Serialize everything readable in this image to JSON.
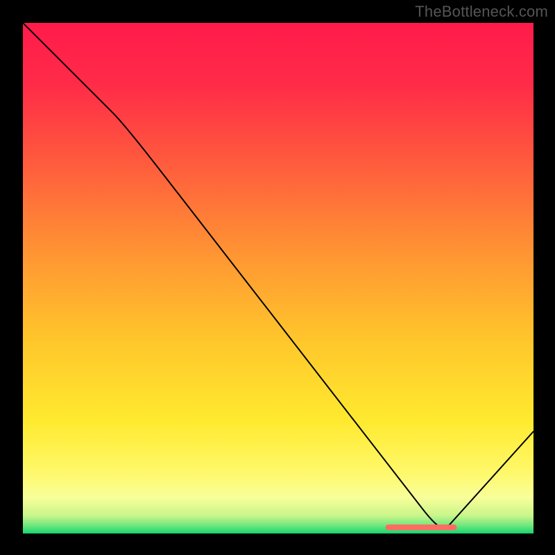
{
  "watermark": "TheBottleneck.com",
  "chart_data": {
    "type": "line",
    "title": "",
    "xlabel": "",
    "ylabel": "",
    "xlim": [
      0,
      100
    ],
    "ylim": [
      0,
      100
    ],
    "categories": [
      0,
      20,
      82,
      100
    ],
    "values": [
      100,
      80,
      0,
      20
    ],
    "series": [
      {
        "name": "curve",
        "x": [
          0,
          20,
          82,
          100
        ],
        "y": [
          100,
          80,
          0,
          20
        ]
      }
    ],
    "gradient_stops": [
      {
        "offset": 0.0,
        "color": "#ff1b4a"
      },
      {
        "offset": 0.12,
        "color": "#ff2b48"
      },
      {
        "offset": 0.28,
        "color": "#ff5d3d"
      },
      {
        "offset": 0.45,
        "color": "#ff9433"
      },
      {
        "offset": 0.62,
        "color": "#ffc62b"
      },
      {
        "offset": 0.78,
        "color": "#ffea2f"
      },
      {
        "offset": 0.88,
        "color": "#fff86a"
      },
      {
        "offset": 0.93,
        "color": "#f8ff9a"
      },
      {
        "offset": 0.965,
        "color": "#c9f58a"
      },
      {
        "offset": 0.985,
        "color": "#6be77d"
      },
      {
        "offset": 1.0,
        "color": "#17d470"
      }
    ],
    "marker": {
      "x_start": 71,
      "x_end": 85,
      "y": 1.2,
      "color": "#ff6b63"
    }
  }
}
